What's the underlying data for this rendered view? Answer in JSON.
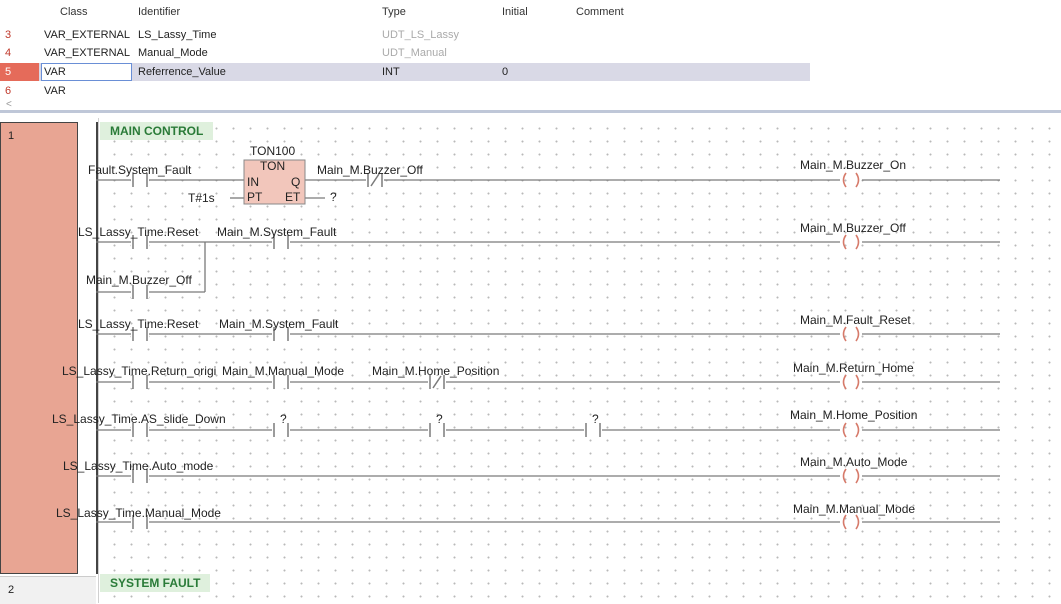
{
  "var_table": {
    "headers": {
      "cls": "Class",
      "ident": "Identifier",
      "type": "Type",
      "init": "Initial",
      "comment": "Comment"
    },
    "rows": [
      {
        "num": "3",
        "cls": "VAR_EXTERNAL",
        "ident": "LS_Lassy_Time",
        "type": "UDT_LS_Lassy",
        "init": ""
      },
      {
        "num": "4",
        "cls": "VAR_EXTERNAL",
        "ident": "Manual_Mode",
        "type": "UDT_Manual",
        "init": ""
      },
      {
        "num": "5",
        "cls": "VAR",
        "ident": "Referrence_Value",
        "type": "INT",
        "init": "0"
      },
      {
        "num": "6",
        "cls": "VAR",
        "ident": "",
        "type": "",
        "init": ""
      }
    ],
    "scroll_glyph": "<"
  },
  "ladder": {
    "rung1": {
      "num": "1",
      "comment": "MAIN CONTROL"
    },
    "rung2": {
      "num": "2",
      "comment": "SYSTEM FAULT"
    },
    "timer": {
      "name": "TON100",
      "type": "TON",
      "in": "IN",
      "q": "Q",
      "pt": "PT",
      "et": "ET",
      "preset": "T#1s",
      "et_var": "?"
    },
    "contacts": {
      "c1": "Fault.System_Fault",
      "c2": "Main_M.Buzzer_Off",
      "c3": "LS_Lassy_Time.Reset",
      "c4": "Main_M.System_Fault",
      "c5": "Main_M.Buzzer_Off",
      "c6": "LS_Lassy_Time.Reset",
      "c7": "Main_M.System_Fault",
      "c8": "LS_Lassy_Time.Return_origi",
      "c9": "Main_M.Manual_Mode",
      "c10": "Main_M.Home_Position",
      "c11": "LS_Lassy_Time.AS_slide_Down",
      "c12": "?",
      "c13": "?",
      "c14": "?",
      "c15": "LS_Lassy_Time.Auto_mode",
      "c16": "LS_Lassy_Time.Manual_Mode"
    },
    "coils": {
      "o1": "Main_M.Buzzer_On",
      "o2": "Main_M.Buzzer_Off",
      "o3": "Main_M.Fault_Reset",
      "o4": "Main_M.Return_Home",
      "o5": "Main_M.Home_Position",
      "o6": "Main_M.Auto_Mode",
      "o7": "Main_M.Manual_Mode"
    }
  }
}
